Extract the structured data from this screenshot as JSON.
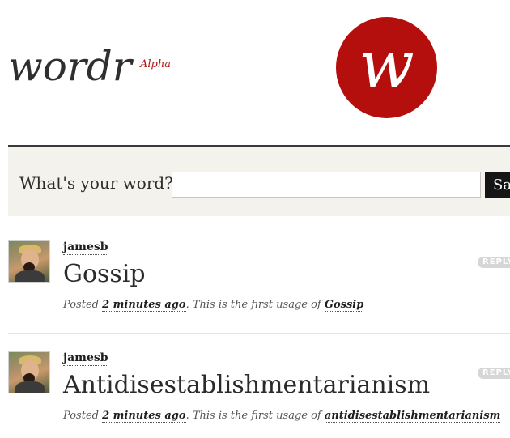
{
  "header": {
    "brand": "wordr",
    "badge": "Alpha",
    "logo_letter": "w"
  },
  "search": {
    "label": "What's your word?",
    "value": "",
    "placeholder": "",
    "button_label": "Save"
  },
  "entries": [
    {
      "username": "jamesb",
      "word": "Gossip",
      "meta_prefix": "Posted ",
      "time": "2 minutes ago",
      "meta_middle": ". This is the first usage of ",
      "usage": "Gossip",
      "reply_label": "REPLY"
    },
    {
      "username": "jamesb",
      "word": "Antidisestablishmentarianism",
      "meta_prefix": "Posted ",
      "time": "2 minutes ago",
      "meta_middle": ". This is the first usage of ",
      "usage": "antidisestablishmentarianism",
      "reply_label": "REPLY"
    }
  ],
  "colors": {
    "accent": "#b40f0d",
    "band": "#f4f2ec"
  }
}
